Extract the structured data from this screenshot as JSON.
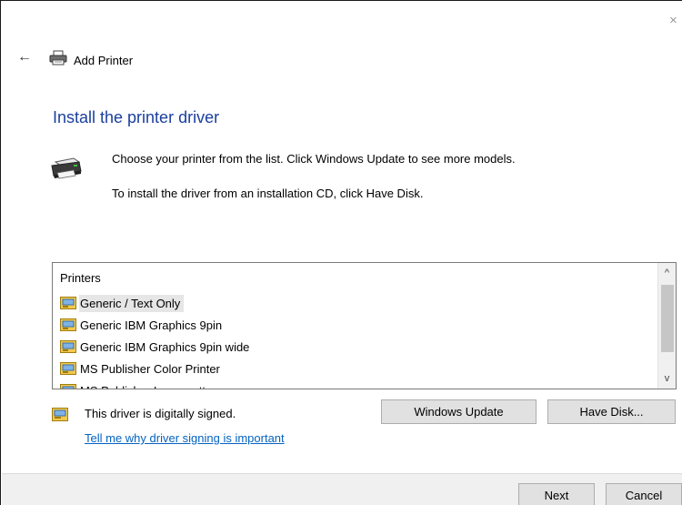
{
  "window": {
    "title": "Add Printer",
    "close_glyph": "×",
    "back_glyph": "←"
  },
  "page": {
    "heading": "Install the printer driver",
    "description_line1": "Choose your printer from the list. Click Windows Update to see more models.",
    "description_line2": "To install the driver from an installation CD, click Have Disk."
  },
  "printers_list": {
    "header": "Printers",
    "items": [
      {
        "label": "Generic / Text Only",
        "selected": true
      },
      {
        "label": "Generic IBM Graphics 9pin",
        "selected": false
      },
      {
        "label": "Generic IBM Graphics 9pin wide",
        "selected": false
      },
      {
        "label": "MS Publisher Color Printer",
        "selected": false
      },
      {
        "label": "MS Publisher Imagesetter",
        "selected": false
      }
    ],
    "scroll_up_glyph": "^",
    "scroll_down_glyph": "v"
  },
  "driver_info": {
    "signed_text": "This driver is digitally signed.",
    "link_text": "Tell me why driver signing is important"
  },
  "buttons": {
    "windows_update": "Windows Update",
    "have_disk": "Have Disk...",
    "next": "Next",
    "cancel": "Cancel"
  },
  "icons": {
    "back": "back-arrow-icon",
    "title": "printer-icon",
    "large": "printer-large-icon",
    "item": "printer-driver-icon",
    "signed": "certificate-icon"
  },
  "colors": {
    "heading": "#1a3f9e",
    "link": "#0563c1",
    "selection": "#e6e6e6",
    "button": "#e1e1e1",
    "footer": "#f0f0f0"
  }
}
